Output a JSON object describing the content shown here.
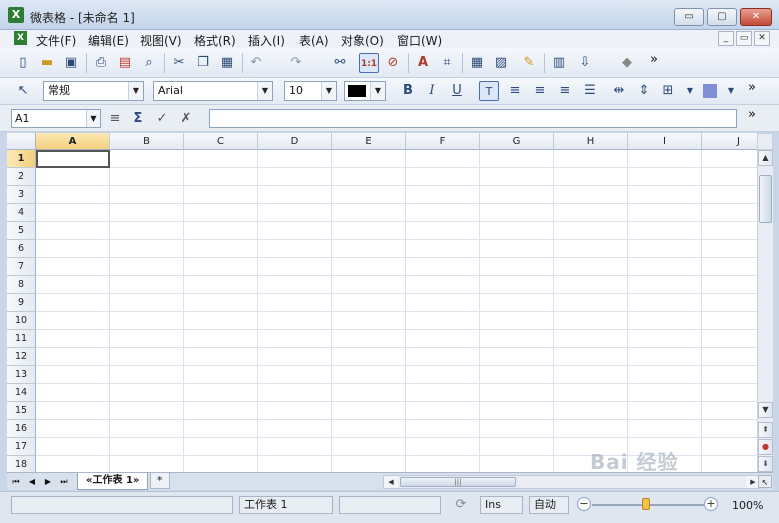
{
  "window": {
    "title": "微表格 - [未命名 1]",
    "app_icon_letter": "X",
    "buttons": {
      "minimize": "▭",
      "restore": "▢",
      "close": "✕"
    }
  },
  "menu": {
    "items": [
      "文件(F)",
      "编辑(E)",
      "视图(V)",
      "格式(R)",
      "插入(I)",
      "表(A)",
      "对象(O)",
      "窗口(W)"
    ],
    "mdi_buttons": [
      "_",
      "▭",
      "✕"
    ]
  },
  "toolbar1": {
    "icons": [
      "new-icon",
      "open-icon",
      "save-icon",
      "print-icon",
      "pdf-icon",
      "print-preview-icon",
      "cut-icon",
      "copy-icon",
      "paste-icon",
      "undo-icon",
      "redo-icon",
      "find-icon",
      "zoom-100-icon",
      "zoom-icon",
      "text-icon",
      "crop-icon",
      "table-icon",
      "fill-icon",
      "paintbrush-icon",
      "chart-icon",
      "sort-icon",
      "object-icon"
    ],
    "overflow": "»"
  },
  "toolbar2": {
    "style": "常规",
    "font": "Arial",
    "size": "10",
    "font_color": "#000000",
    "bold": "B",
    "italic": "I",
    "underline": "U",
    "overflow": "»"
  },
  "formula_bar": {
    "cell_ref": "A1",
    "value": "",
    "overflow": "»"
  },
  "grid": {
    "columns": [
      "A",
      "B",
      "C",
      "D",
      "E",
      "F",
      "G",
      "H",
      "I",
      "J"
    ],
    "rows": [
      "1",
      "2",
      "3",
      "4",
      "5",
      "6",
      "7",
      "8",
      "9",
      "10",
      "11",
      "12",
      "13",
      "14",
      "15",
      "16",
      "17",
      "18"
    ],
    "active_column": "A",
    "active_row": "1"
  },
  "sheets": {
    "tabs": [
      "«工作表 1»"
    ],
    "add_label": "*"
  },
  "status": {
    "sheet": "工作表 1",
    "insert_mode": "Ins",
    "auto": "自动",
    "zoom": "100%"
  },
  "watermark": "Bai 经验",
  "colors": {
    "accent": "#4a6ea9",
    "active_header": "#f3cf7a",
    "fill": "#7f8fd6"
  }
}
